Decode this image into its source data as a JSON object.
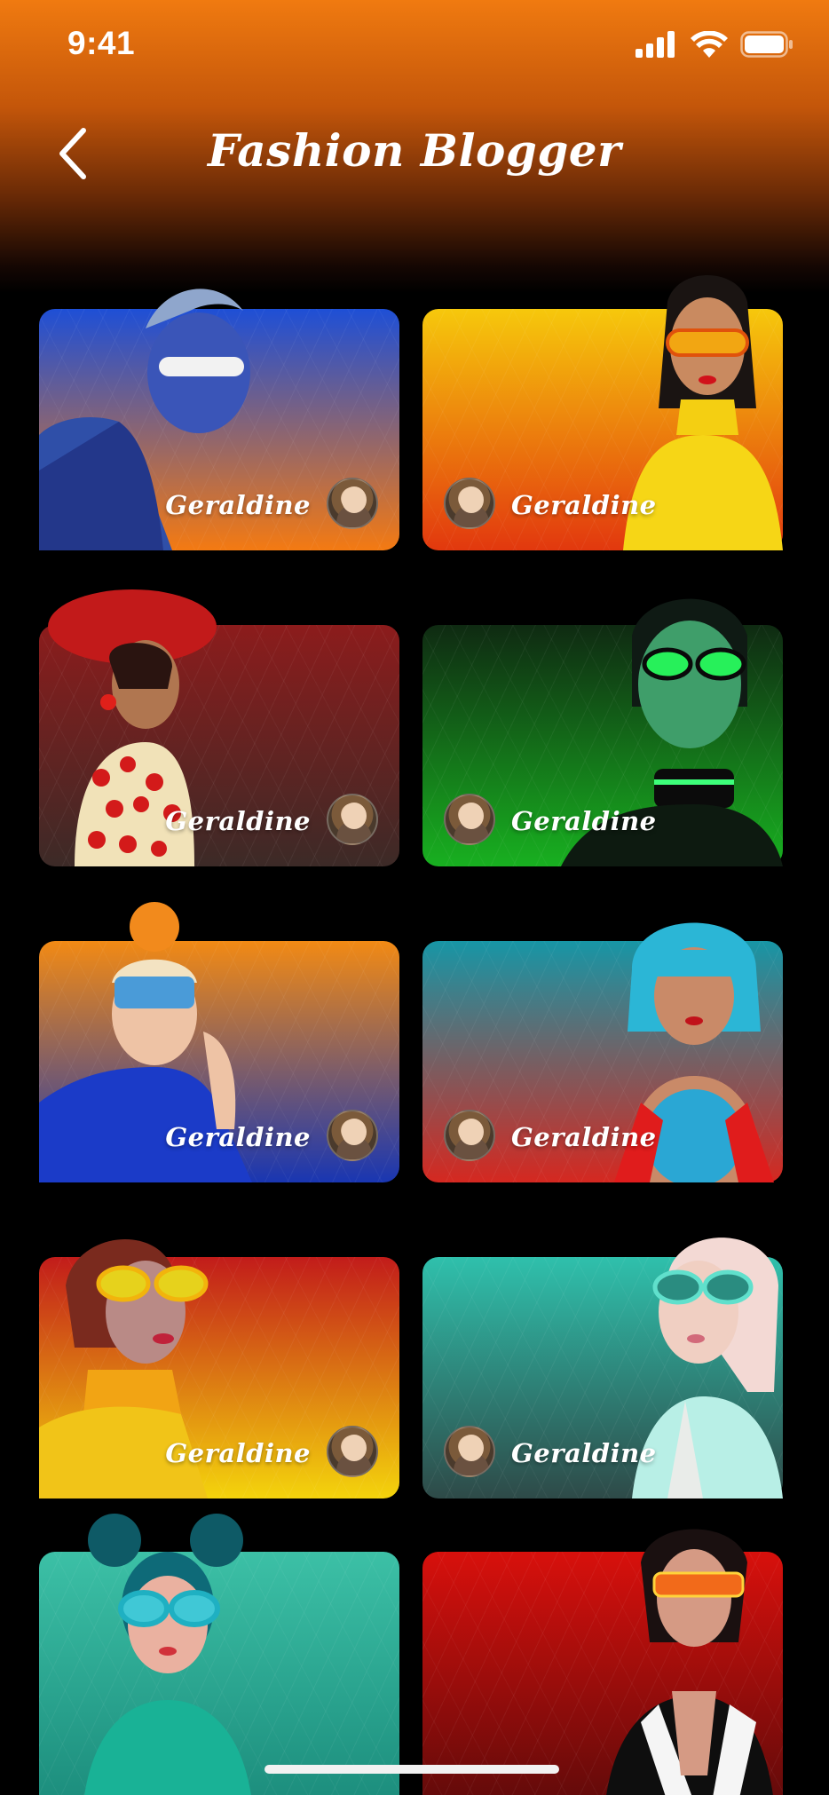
{
  "status_bar": {
    "time": "9:41"
  },
  "header": {
    "title": "Fashion Blogger",
    "back_icon": "chevron-left-icon"
  },
  "cards": [
    {
      "name": "Geraldine",
      "bg_top": "#1e4fd6",
      "bg_bottom": "#f47a12",
      "side": "left"
    },
    {
      "name": "Geraldine",
      "bg_top": "#f6c80c",
      "bg_bottom": "#e2380e",
      "side": "right"
    },
    {
      "name": "Geraldine",
      "bg_top": "#8c1c1c",
      "bg_bottom": "#3c2a27",
      "side": "left"
    },
    {
      "name": "Geraldine",
      "bg_top": "#0f2a12",
      "bg_bottom": "#18b020",
      "side": "right"
    },
    {
      "name": "Geraldine",
      "bg_top": "#f28a14",
      "bg_bottom": "#1936b2",
      "side": "left"
    },
    {
      "name": "Geraldine",
      "bg_top": "#1796a6",
      "bg_bottom": "#d52820",
      "side": "right"
    },
    {
      "name": "Geraldine",
      "bg_top": "#c21c1a",
      "bg_bottom": "#f4d40c",
      "side": "left"
    },
    {
      "name": "Geraldine",
      "bg_top": "#2fc0ac",
      "bg_bottom": "#2e4a48",
      "side": "right"
    },
    {
      "name": "",
      "bg_top": "#3cc0a6",
      "bg_bottom": "#1a8a7a",
      "side": "left"
    },
    {
      "name": "",
      "bg_top": "#d8100c",
      "bg_bottom": "#5a0a0a",
      "side": "right"
    }
  ]
}
